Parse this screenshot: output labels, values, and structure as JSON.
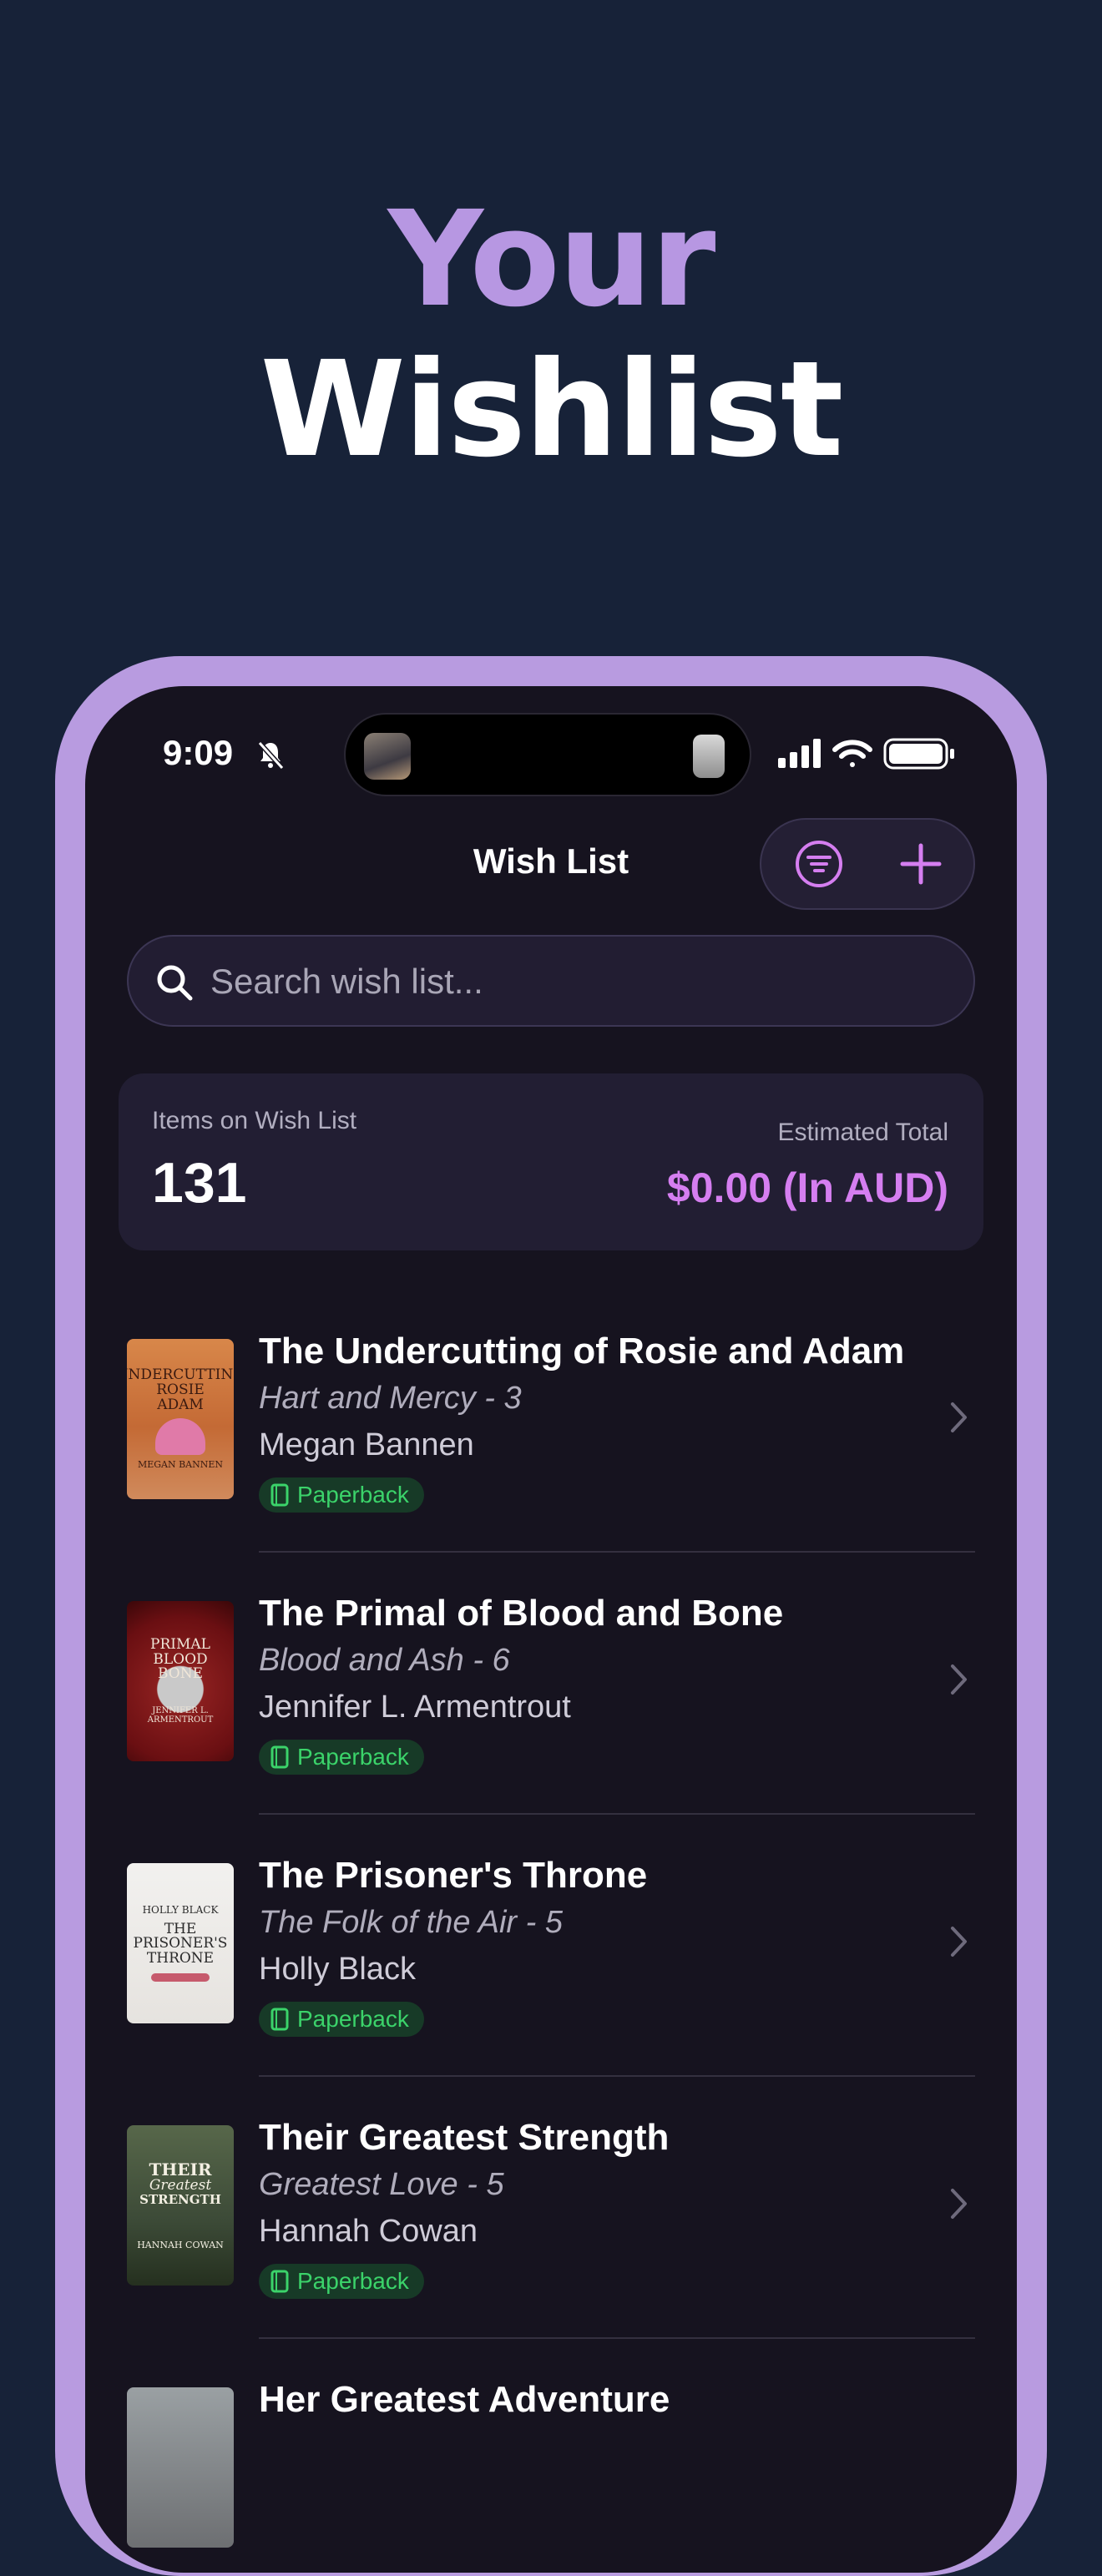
{
  "promo": {
    "line1": "Your",
    "line2": "Wishlist"
  },
  "status_bar": {
    "time": "9:09"
  },
  "nav": {
    "title": "Wish List"
  },
  "search": {
    "placeholder": "Search wish list..."
  },
  "summary": {
    "items_label": "Items on Wish List",
    "items_count": "131",
    "total_label": "Estimated Total",
    "total_value": "$0.00 (In AUD)"
  },
  "books": [
    {
      "title": "The Undercutting of Rosie and Adam",
      "series": "Hart and Mercy - 3",
      "author": "Megan Bannen",
      "format": "Paperback",
      "cover": [
        "UNDERCUTTING",
        "ROSIE",
        "ADAM",
        "MEGAN BANNEN"
      ]
    },
    {
      "title": "The Primal of Blood and Bone",
      "series": "Blood and Ash - 6",
      "author": "Jennifer L. Armentrout",
      "format": "Paperback",
      "cover": [
        "PRIMAL",
        "BLOOD",
        "BONE",
        "JENNIFER L. ARMENTROUT"
      ]
    },
    {
      "title": "The Prisoner's Throne",
      "series": "The Folk of the Air - 5",
      "author": "Holly Black",
      "format": "Paperback",
      "cover": [
        "HOLLY BLACK",
        "THE",
        "PRISONER'S",
        "THRONE"
      ]
    },
    {
      "title": "Their Greatest Strength",
      "series": "Greatest Love - 5",
      "author": "Hannah Cowan",
      "format": "Paperback",
      "cover": [
        "THEIR",
        "Greatest",
        "STRENGTH",
        "HANNAH COWAN"
      ]
    },
    {
      "title": "Her Greatest Adventure"
    }
  ],
  "colors": {
    "accent": "#b89be0",
    "price": "#d57ef0",
    "format_badge": "#3bd36a",
    "background": "#172238"
  }
}
